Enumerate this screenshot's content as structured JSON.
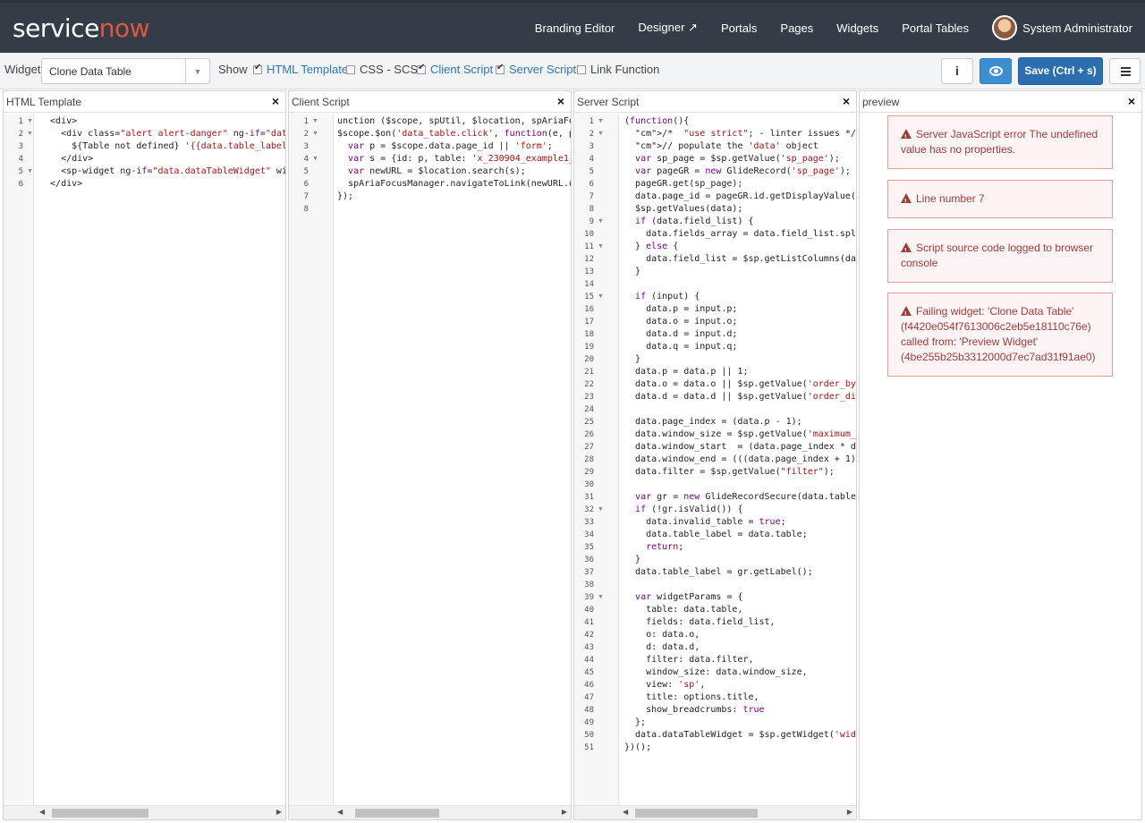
{
  "nav": {
    "logo_service": "service",
    "logo_now": "now",
    "items": [
      "Branding Editor",
      "Designer ↗",
      "Portals",
      "Pages",
      "Widgets",
      "Portal Tables"
    ],
    "user": "System Administrator"
  },
  "toolbar": {
    "widget_label": "Widget",
    "widget_value": "Clone Data Table",
    "show_label": "Show",
    "toggles": [
      {
        "label": "HTML Template",
        "checked": true
      },
      {
        "label": "CSS - SCSS",
        "checked": false
      },
      {
        "label": "Client Script",
        "checked": true
      },
      {
        "label": "Server Script",
        "checked": true
      },
      {
        "label": "Link Function",
        "checked": false
      }
    ],
    "info_label": "i",
    "save_label": "Save (Ctrl + s)"
  },
  "panes": {
    "html": {
      "title": "HTML Template",
      "close": "×",
      "lines": [
        "  <div>",
        "    <div class=\"alert alert-danger\" ng-if=\"data",
        "      ${Table not defined} '{{data.table_label}",
        "    </div>",
        "    <sp-widget ng-if=\"data.dataTableWidget\" wid",
        "  </div>"
      ]
    },
    "client": {
      "title": "Client Script",
      "close": "×",
      "lines": [
        "unction ($scope, spUtil, $location, spAriaFocu",
        "$scope.$on('data_table.click', function(e, pa",
        "  var p = $scope.data.page_id || 'form';",
        "  var s = {id: p, table: 'x_230904_example1_",
        "  var newURL = $location.search(s);",
        "  spAriaFocusManager.navigateToLink(newURL.ur",
        "});",
        ""
      ]
    },
    "server": {
      "title": "Server Script",
      "close": "×",
      "lines": [
        "(function(){",
        "  /*  \"use strict\"; - linter issues */",
        "  // populate the 'data' object",
        "  var sp_page = $sp.getValue('sp_page');",
        "  var pageGR = new GlideRecord('sp_page');",
        "  pageGR.get(sp_page);",
        "  data.page_id = pageGR.id.getDisplayValue(",
        "  $sp.getValues(data);",
        "  if (data.field_list) {",
        "    data.fields_array = data.field_list.spl",
        "  } else {",
        "    data.field_list = $sp.getListColumns(da",
        "  }",
        "",
        "  if (input) {",
        "    data.p = input.p;",
        "    data.o = input.o;",
        "    data.d = input.d;",
        "    data.q = input.q;",
        "  }",
        "  data.p = data.p || 1;",
        "  data.o = data.o || $sp.getValue('order_by",
        "  data.d = data.d || $sp.getValue('order_di",
        "",
        "  data.page_index = (data.p - 1);",
        "  data.window_size = $sp.getValue('maximum_",
        "  data.window_start  = (data.page_index * d",
        "  data.window_end = (((data.page_index + 1)",
        "  data.filter = $sp.getValue(\"filter\");",
        "",
        "  var gr = new GlideRecordSecure(data.table",
        "  if (!gr.isValid()) {",
        "    data.invalid_table = true;",
        "    data.table_label = data.table;",
        "    return;",
        "  }",
        "  data.table_label = gr.getLabel();",
        "",
        "  var widgetParams = {",
        "    table: data.table,",
        "    fields: data.field_list,",
        "    o: data.o,",
        "    d: data.d,",
        "    filter: data.filter,",
        "    window_size: data.window_size,",
        "    view: 'sp',",
        "    title: options.title,",
        "    show_breadcrumbs: true",
        "  };",
        "  data.dataTableWidget = $sp.getWidget('wid",
        "})();"
      ]
    },
    "preview": {
      "title": "preview",
      "close": "×",
      "alerts": [
        "Server JavaScript error The undefined value has no properties.",
        "Line number 7",
        "Script source code logged to browser console",
        "Failing widget: 'Clone Data Table' (f4420e054f7613006c2eb5e18110c76e) called from: 'Preview Widget' (4be255b25b3312000d7ec7ad31f91ae0)"
      ]
    }
  }
}
